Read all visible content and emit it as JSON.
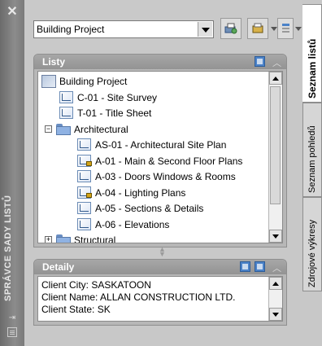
{
  "window": {
    "vertical_title": "SPRÁVCE SADY LISTŮ",
    "close_glyph": "✕"
  },
  "toolbar": {
    "sheet_set_value": "Building Project"
  },
  "sheets_panel": {
    "title": "Listy",
    "tree": [
      {
        "label": "Building Project",
        "type": "root",
        "level": 0
      },
      {
        "label": "C-01 - Site Survey",
        "type": "sheet",
        "level": 1,
        "locked": false
      },
      {
        "label": "T-01 - Title Sheet",
        "type": "sheet",
        "level": 1,
        "locked": false
      },
      {
        "label": "Architectural",
        "type": "group",
        "level": 1,
        "expanded": true
      },
      {
        "label": "AS-01 - Architectural Site Plan",
        "type": "sheet",
        "level": 2,
        "locked": false
      },
      {
        "label": "A-01 - Main & Second Floor Plans",
        "type": "sheet",
        "level": 2,
        "locked": true
      },
      {
        "label": "A-03 - Doors Windows & Rooms",
        "type": "sheet",
        "level": 2,
        "locked": false
      },
      {
        "label": "A-04 - Lighting Plans",
        "type": "sheet",
        "level": 2,
        "locked": true
      },
      {
        "label": "A-05 - Sections & Details",
        "type": "sheet",
        "level": 2,
        "locked": false
      },
      {
        "label": "A-06 - Elevations",
        "type": "sheet",
        "level": 2,
        "locked": false
      },
      {
        "label": "Structural",
        "type": "group",
        "level": 1,
        "expanded": false
      }
    ]
  },
  "details_panel": {
    "title": "Detaily",
    "lines": [
      "Client City: SASKATOON",
      "Client Name: ALLAN CONSTRUCTION LTD.",
      "Client State: SK"
    ]
  },
  "side_tabs": [
    {
      "label": "Seznam listů",
      "active": true
    },
    {
      "label": "Seznam pohledů",
      "active": false
    },
    {
      "label": "Zdrojové výkresy",
      "active": false
    }
  ],
  "colors": {
    "panel_header": "#9a9a9a",
    "window_bar": "#7a7a7a",
    "accent_blue": "#4b82c8"
  }
}
